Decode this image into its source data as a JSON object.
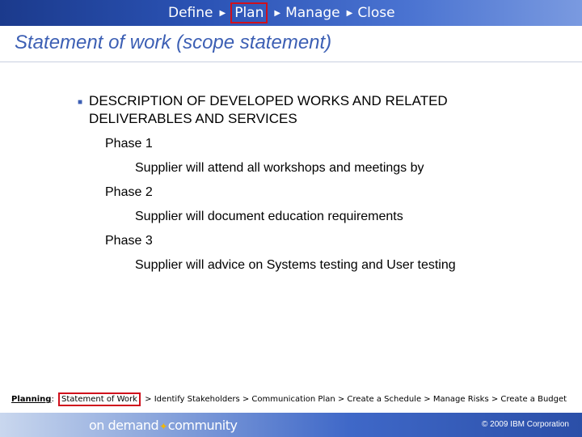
{
  "nav": {
    "items": [
      {
        "label": "Define"
      },
      {
        "label": "Plan",
        "active": true
      },
      {
        "label": "Manage"
      },
      {
        "label": "Close"
      }
    ]
  },
  "title": "Statement of work (scope statement)",
  "content": {
    "heading_line1": "DESCRIPTION OF DEVELOPED WORKS AND RELATED",
    "heading_line2": "DELIVERABLES AND SERVICES",
    "phases": [
      {
        "label": "Phase 1",
        "detail": "Supplier will attend all workshops and meetings by"
      },
      {
        "label": "Phase 2",
        "detail": "Supplier will document education requirements"
      },
      {
        "label": "Phase 3",
        "detail": "Supplier will advice on Systems testing and User testing"
      }
    ]
  },
  "breadcrumb": {
    "lead": "Planning",
    "lead_suffix": ":",
    "current": "Statement of Work",
    "rest": "> Identify Stakeholders  >  Communication Plan  >  Create a Schedule  >  Manage Risks  >  Create a Budget"
  },
  "footer": {
    "brand_part1": "on demand",
    "brand_part2": "community",
    "copyright": "© 2009 IBM Corporation"
  },
  "colors": {
    "accent": "#3c5fb4",
    "highlight": "#d0101c"
  }
}
